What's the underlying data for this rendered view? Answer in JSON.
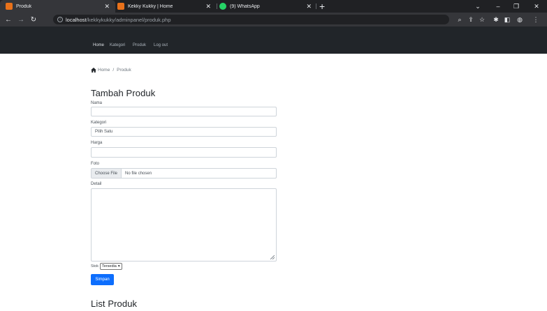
{
  "browser": {
    "tabs": [
      {
        "title": "Produk",
        "favicon_color": "#e8711a"
      },
      {
        "title": "Kekky Kukky | Home",
        "favicon_color": "#e8711a"
      },
      {
        "title": "(9) WhatsApp",
        "favicon_color": "#25d366"
      }
    ],
    "new_tab": "+",
    "url_host": "localhost",
    "url_path": "/kekkykukky/adminpanel/produk.php"
  },
  "navbar": {
    "items": [
      "Home",
      "Kategori",
      "Produk",
      "Log out"
    ]
  },
  "breadcrumb": {
    "home": "Home",
    "separator": "/",
    "current": "Produk"
  },
  "form": {
    "heading": "Tambah Produk",
    "nama_label": "Nama",
    "nama_value": "",
    "kategori_label": "Kategori",
    "kategori_value": "Pilih Satu",
    "harga_label": "Harga",
    "harga_value": "",
    "foto_label": "Foto",
    "choose_file": "Choose File",
    "no_file": "No file chosen",
    "detail_label": "Detail",
    "stok_label": "Stok",
    "stok_value": "Tersedia",
    "submit_label": "Simpan"
  },
  "list": {
    "heading": "List Produk"
  },
  "colors": {
    "primary": "#0d6efd",
    "navbar_bg": "#212529",
    "chrome_bg": "#202124"
  }
}
